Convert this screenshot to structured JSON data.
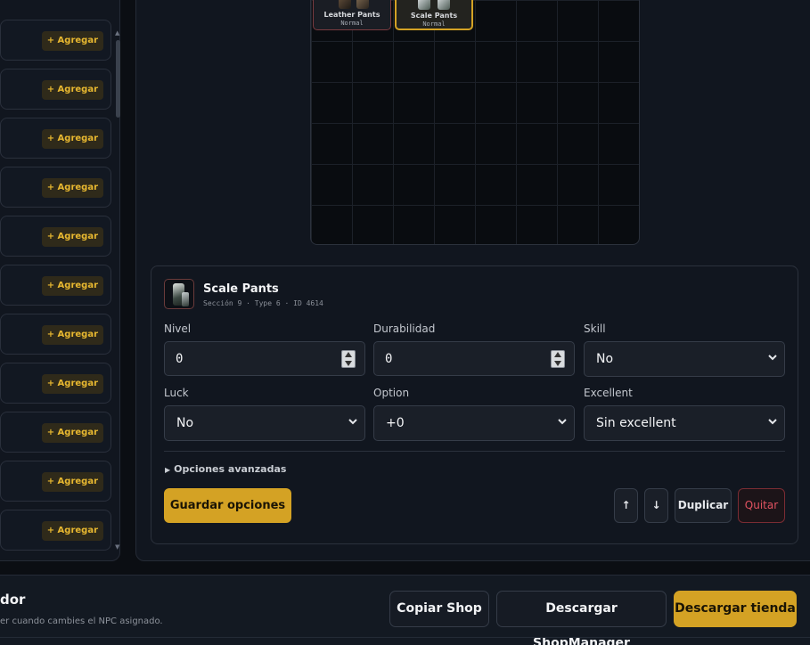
{
  "npc_list": {
    "add_label": "+ Agregar",
    "rows": [
      {
        "action": "+ Agregar"
      },
      {
        "action": "+ Agregar"
      },
      {
        "action": "+ Agregar"
      },
      {
        "action": "+ Agregar"
      },
      {
        "action": "+ Agregar"
      },
      {
        "action": "+ Agregar"
      },
      {
        "action": "+ Agregar"
      },
      {
        "action": "+ Agregar"
      },
      {
        "action": "+ Agregar"
      },
      {
        "action": "+ Agregar"
      },
      {
        "action": "+ Agregar"
      }
    ],
    "scroll_up_icon": "▲",
    "scroll_down_icon": "▼"
  },
  "inventory": {
    "slots": [
      {
        "name": "Leather Pants",
        "quality": "Normal",
        "selected": false
      },
      {
        "name": "Scale Pants",
        "quality": "Normal",
        "selected": true
      }
    ]
  },
  "editor": {
    "item_name": "Scale Pants",
    "item_meta": "Sección 9 · Type 6 · ID 4614",
    "fields": {
      "nivel": {
        "label": "Nivel",
        "value": "0"
      },
      "durabilidad": {
        "label": "Durabilidad",
        "value": "0"
      },
      "skill": {
        "label": "Skill",
        "value": "No"
      },
      "luck": {
        "label": "Luck",
        "value": "No"
      },
      "option": {
        "label": "Option",
        "value": "+0"
      },
      "excellent": {
        "label": "Excellent",
        "value": "Sin excellent"
      }
    },
    "advanced_toggle": "Opciones avanzadas",
    "save_label": "Guardar opciones",
    "move_up_label": "↑",
    "move_down_label": "↓",
    "duplicate_label": "Duplicar",
    "remove_label": "Quitar"
  },
  "footer": {
    "title": "dor",
    "subtitle": "er cuando cambies el NPC asignado.",
    "copy_shop_label": "Copiar Shop",
    "download_manager_label": "Descargar ShopManager",
    "download_shop_label": "Descargar tienda"
  },
  "colors": {
    "accent": "#d4a224",
    "danger": "#e05260",
    "background": "#0b0e13"
  }
}
